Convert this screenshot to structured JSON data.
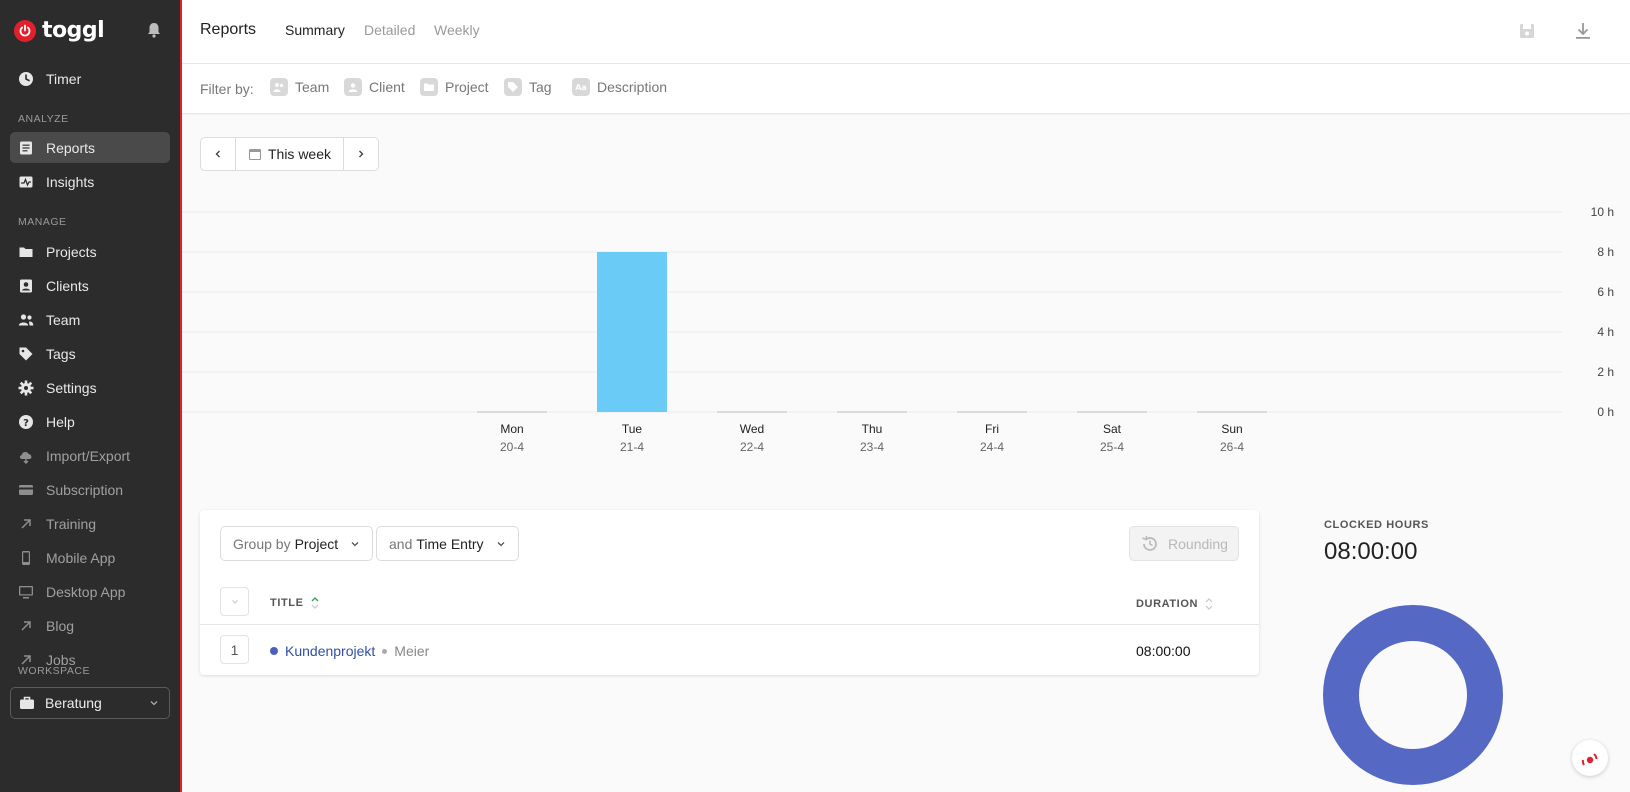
{
  "brand": {
    "name": "toggl",
    "accent": "#e2202b"
  },
  "sidebar": {
    "items_top": [
      {
        "label": "Timer",
        "icon": "clock-icon"
      }
    ],
    "analyze_label": "ANALYZE",
    "analyze": [
      {
        "label": "Reports",
        "icon": "reports-icon",
        "active": true
      },
      {
        "label": "Insights",
        "icon": "insights-icon"
      }
    ],
    "manage_label": "MANAGE",
    "manage": [
      {
        "label": "Projects",
        "icon": "folder-icon"
      },
      {
        "label": "Clients",
        "icon": "client-icon"
      },
      {
        "label": "Team",
        "icon": "team-icon"
      },
      {
        "label": "Tags",
        "icon": "tag-icon"
      },
      {
        "label": "Settings",
        "icon": "gear-icon"
      },
      {
        "label": "Help",
        "icon": "help-icon"
      },
      {
        "label": "Import/Export",
        "icon": "import-export-icon"
      },
      {
        "label": "Subscription",
        "icon": "card-icon"
      },
      {
        "label": "Training",
        "icon": "external-link-icon"
      },
      {
        "label": "Mobile App",
        "icon": "phone-icon"
      },
      {
        "label": "Desktop App",
        "icon": "monitor-icon"
      },
      {
        "label": "Blog",
        "icon": "external-link-icon"
      },
      {
        "label": "Jobs",
        "icon": "external-link-icon"
      }
    ],
    "workspace_label": "WORKSPACE",
    "workspace_value": "Beratung"
  },
  "header": {
    "title": "Reports",
    "tabs": [
      "Summary",
      "Detailed",
      "Weekly"
    ]
  },
  "filter": {
    "label": "Filter by:",
    "items": [
      "Team",
      "Client",
      "Project",
      "Tag",
      "Description"
    ]
  },
  "date_picker": {
    "label": "This week"
  },
  "chart_data": {
    "type": "bar",
    "categories": [
      "Mon",
      "Tue",
      "Wed",
      "Thu",
      "Fri",
      "Sat",
      "Sun"
    ],
    "dates": [
      "20-4",
      "21-4",
      "22-4",
      "23-4",
      "24-4",
      "25-4",
      "26-4"
    ],
    "values": [
      0,
      8,
      0,
      0,
      0,
      0,
      0
    ],
    "ylim": [
      0,
      10
    ],
    "yticks": [
      "0 h",
      "2 h",
      "4 h",
      "6 h",
      "8 h",
      "10 h"
    ],
    "bar_color": "#6bcbf7"
  },
  "table": {
    "group_by_prefix": "Group by",
    "group_by_value": "Project",
    "and_prefix": "and",
    "and_value": "Time Entry",
    "rounding_label": "Rounding",
    "col_title": "TITLE",
    "col_duration": "DURATION",
    "rows": [
      {
        "num": "1",
        "project": "Kundenprojekt",
        "client": "Meier",
        "duration": "08:00:00",
        "color": "#4b5fc0"
      }
    ]
  },
  "clocked": {
    "label": "CLOCKED HOURS",
    "value": "08:00:00",
    "donut_color": "#5468c4"
  }
}
